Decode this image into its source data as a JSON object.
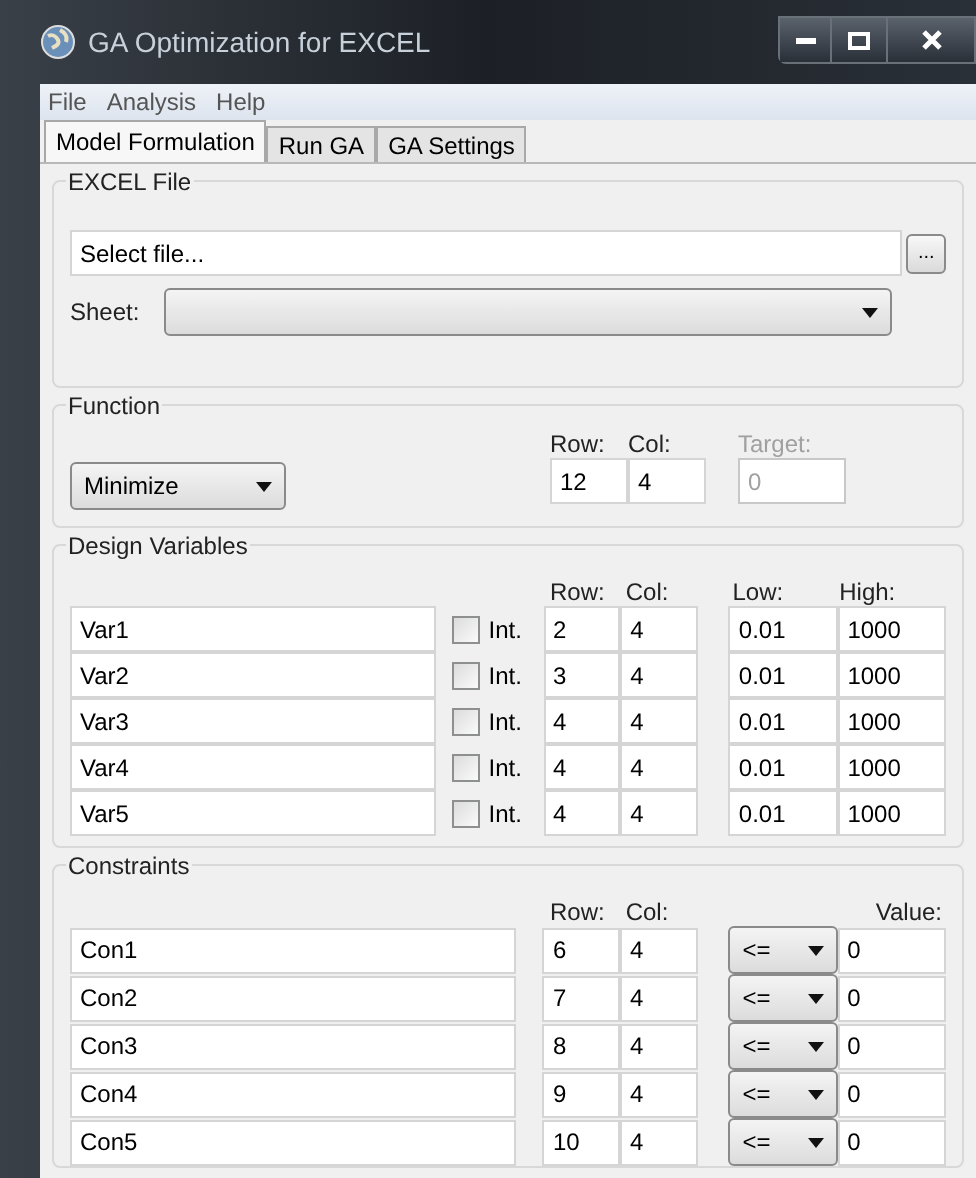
{
  "window": {
    "title": "GA Optimization for EXCEL"
  },
  "menu": [
    "File",
    "Analysis",
    "Help"
  ],
  "tabs": [
    {
      "label": "Model Formulation",
      "selected": true
    },
    {
      "label": "Run GA",
      "selected": false
    },
    {
      "label": "GA Settings",
      "selected": false
    }
  ],
  "excel_file": {
    "legend": "EXCEL File",
    "file": "Select file...",
    "browse_button": "...",
    "sheet_label": "Sheet:"
  },
  "function": {
    "legend": "Function",
    "mode": "Minimize",
    "row_label": "Row:",
    "col_label": "Col:",
    "target_label": "Target:",
    "row": "12",
    "col": "4",
    "target": "0",
    "target_disabled": true
  },
  "design_variables": {
    "legend": "Design Variables",
    "row_label": "Row:",
    "col_label": "Col:",
    "low_label": "Low:",
    "high_label": "High:",
    "rows": [
      {
        "name": "Var1",
        "int_label": "Int.",
        "checked": false,
        "row": "2",
        "col": "4",
        "low": "0.01",
        "high": "1000"
      },
      {
        "name": "Var2",
        "int_label": "Int.",
        "checked": false,
        "row": "3",
        "col": "4",
        "low": "0.01",
        "high": "1000"
      },
      {
        "name": "Var3",
        "int_label": "Int.",
        "checked": false,
        "row": "4",
        "col": "4",
        "low": "0.01",
        "high": "1000"
      },
      {
        "name": "Var4",
        "int_label": "Int.",
        "checked": false,
        "row": "4",
        "col": "4",
        "low": "0.01",
        "high": "1000"
      },
      {
        "name": "Var5",
        "int_label": "Int.",
        "checked": false,
        "row": "4",
        "col": "4",
        "low": "0.01",
        "high": "1000"
      }
    ]
  },
  "constraints": {
    "legend": "Constraints",
    "row_label": "Row:",
    "col_label": "Col:",
    "value_label": "Value:",
    "rows": [
      {
        "name": "Con1",
        "row": "6",
        "col": "4",
        "operator": "<=",
        "value": "0"
      },
      {
        "name": "Con2",
        "row": "7",
        "col": "4",
        "operator": "<=",
        "value": "0"
      },
      {
        "name": "Con3",
        "row": "8",
        "col": "4",
        "operator": "<=",
        "value": "0"
      },
      {
        "name": "Con4",
        "row": "9",
        "col": "4",
        "operator": "<=",
        "value": "0"
      },
      {
        "name": "Con5",
        "row": "10",
        "col": "4",
        "operator": "<=",
        "value": "0"
      }
    ]
  }
}
